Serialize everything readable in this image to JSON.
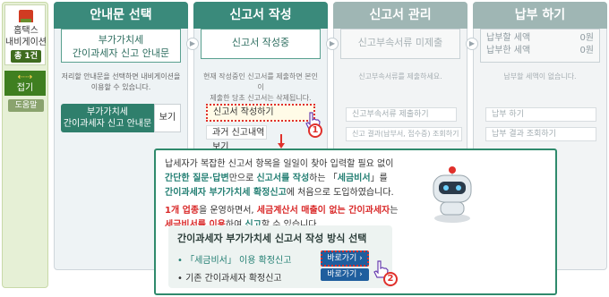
{
  "nav": {
    "title_line1": "홈택스",
    "title_line2": "내비게이션",
    "count": "총 1건",
    "fold_arrow": "⇠⇢",
    "fold_label": "접기",
    "help": "도움말"
  },
  "steps": [
    {
      "title": "안내문 선택",
      "box_line1": "부가가치세",
      "box_line2": "간이과세자 신고 안내문",
      "desc_line1": "저리할 안내문을 선택하면 내비게이션을",
      "desc_line2": "이용할 수 있습니다.",
      "guide_line1": "부가가치세",
      "guide_line2": "간이과세자 신고 안내문",
      "view": "보기"
    },
    {
      "title": "신고서 작성",
      "box": "신고서 작성중",
      "desc_line1": "현재 작성중인 신고서를 제출하면 본인이",
      "desc_line2": "제출한 당초 신고서는 삭제됩니다.",
      "write": "신고서 작성하기",
      "past": "과거 신고내역 보기"
    },
    {
      "title": "신고서 관리",
      "box": "신고부속서류 미제출",
      "desc": "신고부속서류를 제출하세요.",
      "btn1": "신고부속서류 제출하기",
      "btn2": "신고 결과(납부서, 접수증) 조회하기"
    },
    {
      "title": "납부 하기",
      "row1_label": "납부할 세액",
      "row1_value": "0원",
      "row2_label": "납부한 세액",
      "row2_value": "0원",
      "desc": "납부할 세액이 없습니다.",
      "btn1": "납부 하기",
      "btn2": "납부 결과 조회하기"
    }
  ],
  "callout": {
    "p1": "납세자가 복잡한 신고서 항목을 일일이 찾아 입력할 필요 없이",
    "p2a": "간단한 질문·답변",
    "p2b": "만으로 ",
    "p2c": "신고서를 작성",
    "p2d": "하는 「",
    "p2e": "세금비서",
    "p2f": "」를",
    "p3a": "간이과세자 부가가치세 확정신고",
    "p3b": "에 처음으로 도입하였습니다.",
    "p4a": "1개 업종",
    "p4b": "을 운영하면서, ",
    "p4c": "세금계산서 매출이 없는 간이과세자",
    "p4d": "는",
    "p5a": "세금비서를 이용",
    "p5b": "하여 ",
    "p5c": "신고",
    "p5d": "할 수 있습니다.",
    "choice_title": "간이과세자 부가가치세 신고서 작성 방식 선택",
    "choice1": "• 「세금비서」 이용 확정신고",
    "choice2": "• 기존 간이과세자 확정신고",
    "go": "바로가기 ›"
  },
  "badges": [
    "1",
    "2"
  ],
  "icons": [
    "home-icon",
    "hand-pointer-icon",
    "robot-icon",
    "arrow-down-icon",
    "chevron-right-icon"
  ],
  "colors": {
    "header_active": "#3a8a7b",
    "header_inactive": "#9fb6b4",
    "accent_red": "#e0302b",
    "button_blue": "#1f5e9e"
  }
}
